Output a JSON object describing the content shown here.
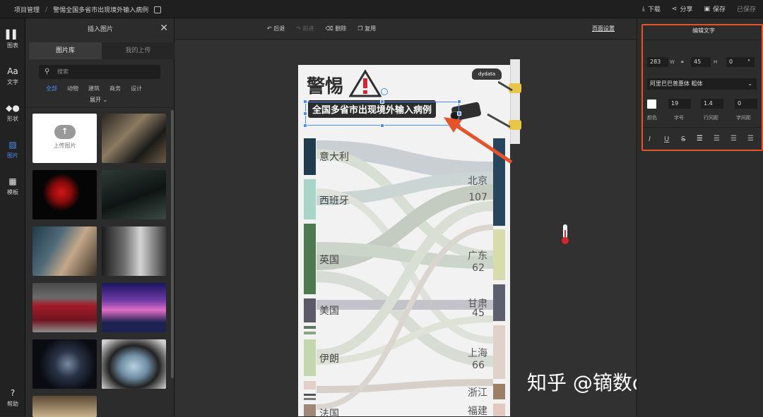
{
  "topbar": {
    "breadcrumb_root": "项目管理",
    "breadcrumb_sep": "/",
    "document_title": "警惕全国多省市出现境外输入病例",
    "actions": {
      "download": "下载",
      "share": "分享",
      "save": "保存",
      "saved_status": "已保存"
    }
  },
  "leftnav": [
    {
      "label": "图表",
      "icon": "chart-icon"
    },
    {
      "label": "文字",
      "icon": "text-icon",
      "glyph": "Aa"
    },
    {
      "label": "形状",
      "icon": "shape-icon"
    },
    {
      "label": "图片",
      "icon": "image-icon",
      "active": true
    },
    {
      "label": "模板",
      "icon": "template-icon"
    },
    {
      "label": "帮助",
      "icon": "help-icon"
    }
  ],
  "image_panel": {
    "title": "插入图片",
    "tabs": [
      "图片库",
      "我的上传"
    ],
    "search_placeholder": "搜索",
    "categories": [
      "全部",
      "动物",
      "建筑",
      "商务",
      "设计"
    ],
    "expand_label": "展开",
    "upload_label": "上传图片"
  },
  "toolbar": {
    "undo": "后退",
    "redo": "前进",
    "delete": "删除",
    "duplicate": "复用",
    "page_setup": "页面设置"
  },
  "poster": {
    "title": "警惕",
    "subtitle": "全国多省市出现境外输入病例",
    "camera_logo": "dydata",
    "sources": [
      "意大利",
      "西班牙",
      "英国",
      "美国",
      "伊朗",
      "法国"
    ],
    "destinations": [
      {
        "name": "北京",
        "value": "107"
      },
      {
        "name": "广东",
        "value": "62"
      },
      {
        "name": "甘肃",
        "value": "45"
      },
      {
        "name": "上海",
        "value": "66"
      },
      {
        "name": "浙江",
        "value": ""
      },
      {
        "name": "福建",
        "value": ""
      }
    ]
  },
  "watermark": "知乎 @镝数dydata.io",
  "props": {
    "title": "编辑文字",
    "width_value": "283",
    "width_label": "W",
    "height_value": "45",
    "height_label": "H",
    "rotation_value": "0",
    "rotation_unit": "°",
    "font_family": "阿里巴巴普惠体 粗体",
    "font_size": "19",
    "line_height": "1.4",
    "letter_spacing": "0",
    "labels": {
      "color": "颜色",
      "size": "字号",
      "line_height": "行间距",
      "letter_spacing": "字间距"
    },
    "text_color": "#ffffff",
    "highlight_color": "#e5532a"
  }
}
